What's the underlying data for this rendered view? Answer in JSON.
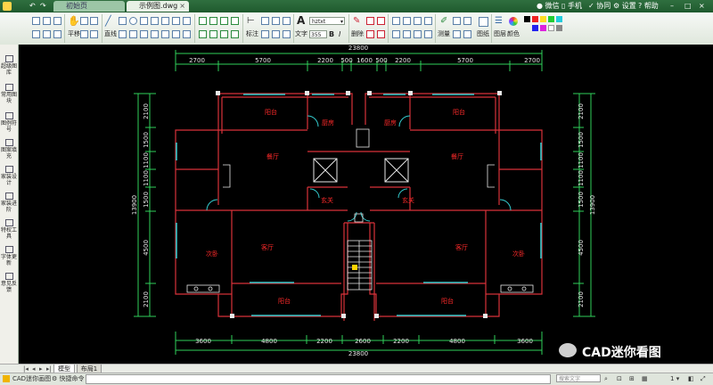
{
  "titlebar": {
    "tabs": [
      {
        "label": "初始页",
        "active": false
      },
      {
        "label": "示例图.dwg",
        "active": true
      }
    ],
    "right_items": [
      "微信",
      "手机",
      "协同",
      "设置",
      "帮助"
    ]
  },
  "ribbon": {
    "pan_label": "平移",
    "line_label": "直线",
    "dim_label": "标注",
    "text_label": "文字",
    "font_value": "hztxt",
    "size_value": "355",
    "delete_label": "删除",
    "measure_label": "测量",
    "layer_label": "图层",
    "color_label": "颜色",
    "bold": "B",
    "italic": "I"
  },
  "leftbar": [
    {
      "label": "超级图库"
    },
    {
      "label": "常用图块"
    },
    {
      "label": "图例符号"
    },
    {
      "label": "图案填充"
    },
    {
      "label": "家装设计"
    },
    {
      "label": "家装进阶"
    },
    {
      "label": "特权工具"
    },
    {
      "label": "字体更新"
    },
    {
      "label": "意见反馈"
    }
  ],
  "drawing": {
    "overall": "23800",
    "top_dims": [
      "2700",
      "5700",
      "2200",
      "500",
      "1600",
      "500",
      "2200",
      "5700",
      "2700"
    ],
    "bottom_dims": [
      "3600",
      "4800",
      "2200",
      "2600",
      "2200",
      "4800",
      "3600"
    ],
    "left_dims": [
      "2100",
      "1500",
      "1100",
      "1100",
      "1500",
      "4500",
      "2100"
    ],
    "right_dims": [
      "2100",
      "1500",
      "1100",
      "1100",
      "1500",
      "4500",
      "2100"
    ],
    "side_total": "13900",
    "rooms": {
      "balcony": "阳台",
      "kitchen": "厨房",
      "dining": "餐厅",
      "foyer": "玄关",
      "living": "客厅",
      "bedroom": "次卧"
    }
  },
  "model_tabs": [
    "模型",
    "布局1"
  ],
  "status": {
    "app_label": "CAD迷你画图",
    "cmd_label": "快捷命令",
    "search_placeholder": "搜索文字",
    "zoom_value": "1"
  },
  "watermark": "CAD迷你看图",
  "colors": {
    "title_bg": "#1f5a2e",
    "wall": "#d9323a",
    "dim": "#2fd15a",
    "window": "#33c9cc",
    "room_label": "#ff2a2a",
    "accent_green": "#2b8a3e"
  }
}
